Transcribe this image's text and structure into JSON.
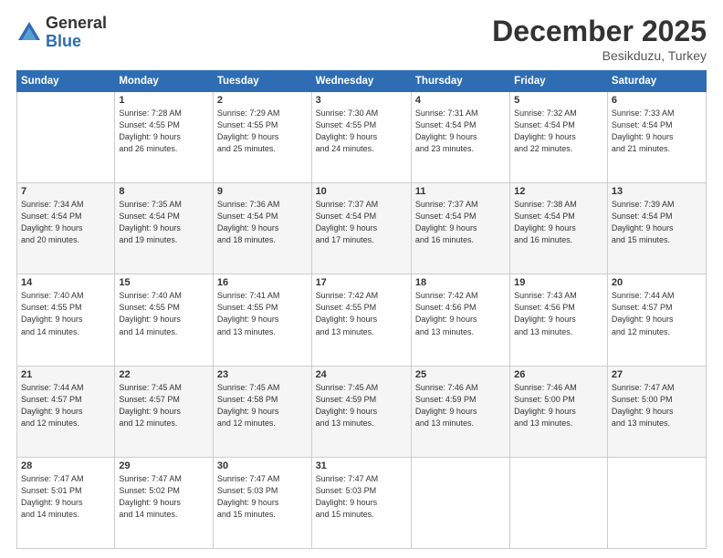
{
  "logo": {
    "general": "General",
    "blue": "Blue"
  },
  "header": {
    "month": "December 2025",
    "location": "Besikduzu, Turkey"
  },
  "days_of_week": [
    "Sunday",
    "Monday",
    "Tuesday",
    "Wednesday",
    "Thursday",
    "Friday",
    "Saturday"
  ],
  "weeks": [
    [
      {
        "day": "",
        "content": ""
      },
      {
        "day": "1",
        "content": "Sunrise: 7:28 AM\nSunset: 4:55 PM\nDaylight: 9 hours\nand 26 minutes."
      },
      {
        "day": "2",
        "content": "Sunrise: 7:29 AM\nSunset: 4:55 PM\nDaylight: 9 hours\nand 25 minutes."
      },
      {
        "day": "3",
        "content": "Sunrise: 7:30 AM\nSunset: 4:55 PM\nDaylight: 9 hours\nand 24 minutes."
      },
      {
        "day": "4",
        "content": "Sunrise: 7:31 AM\nSunset: 4:54 PM\nDaylight: 9 hours\nand 23 minutes."
      },
      {
        "day": "5",
        "content": "Sunrise: 7:32 AM\nSunset: 4:54 PM\nDaylight: 9 hours\nand 22 minutes."
      },
      {
        "day": "6",
        "content": "Sunrise: 7:33 AM\nSunset: 4:54 PM\nDaylight: 9 hours\nand 21 minutes."
      }
    ],
    [
      {
        "day": "7",
        "content": "Sunrise: 7:34 AM\nSunset: 4:54 PM\nDaylight: 9 hours\nand 20 minutes."
      },
      {
        "day": "8",
        "content": "Sunrise: 7:35 AM\nSunset: 4:54 PM\nDaylight: 9 hours\nand 19 minutes."
      },
      {
        "day": "9",
        "content": "Sunrise: 7:36 AM\nSunset: 4:54 PM\nDaylight: 9 hours\nand 18 minutes."
      },
      {
        "day": "10",
        "content": "Sunrise: 7:37 AM\nSunset: 4:54 PM\nDaylight: 9 hours\nand 17 minutes."
      },
      {
        "day": "11",
        "content": "Sunrise: 7:37 AM\nSunset: 4:54 PM\nDaylight: 9 hours\nand 16 minutes."
      },
      {
        "day": "12",
        "content": "Sunrise: 7:38 AM\nSunset: 4:54 PM\nDaylight: 9 hours\nand 16 minutes."
      },
      {
        "day": "13",
        "content": "Sunrise: 7:39 AM\nSunset: 4:54 PM\nDaylight: 9 hours\nand 15 minutes."
      }
    ],
    [
      {
        "day": "14",
        "content": "Sunrise: 7:40 AM\nSunset: 4:55 PM\nDaylight: 9 hours\nand 14 minutes."
      },
      {
        "day": "15",
        "content": "Sunrise: 7:40 AM\nSunset: 4:55 PM\nDaylight: 9 hours\nand 14 minutes."
      },
      {
        "day": "16",
        "content": "Sunrise: 7:41 AM\nSunset: 4:55 PM\nDaylight: 9 hours\nand 13 minutes."
      },
      {
        "day": "17",
        "content": "Sunrise: 7:42 AM\nSunset: 4:55 PM\nDaylight: 9 hours\nand 13 minutes."
      },
      {
        "day": "18",
        "content": "Sunrise: 7:42 AM\nSunset: 4:56 PM\nDaylight: 9 hours\nand 13 minutes."
      },
      {
        "day": "19",
        "content": "Sunrise: 7:43 AM\nSunset: 4:56 PM\nDaylight: 9 hours\nand 13 minutes."
      },
      {
        "day": "20",
        "content": "Sunrise: 7:44 AM\nSunset: 4:57 PM\nDaylight: 9 hours\nand 12 minutes."
      }
    ],
    [
      {
        "day": "21",
        "content": "Sunrise: 7:44 AM\nSunset: 4:57 PM\nDaylight: 9 hours\nand 12 minutes."
      },
      {
        "day": "22",
        "content": "Sunrise: 7:45 AM\nSunset: 4:57 PM\nDaylight: 9 hours\nand 12 minutes."
      },
      {
        "day": "23",
        "content": "Sunrise: 7:45 AM\nSunset: 4:58 PM\nDaylight: 9 hours\nand 12 minutes."
      },
      {
        "day": "24",
        "content": "Sunrise: 7:45 AM\nSunset: 4:59 PM\nDaylight: 9 hours\nand 13 minutes."
      },
      {
        "day": "25",
        "content": "Sunrise: 7:46 AM\nSunset: 4:59 PM\nDaylight: 9 hours\nand 13 minutes."
      },
      {
        "day": "26",
        "content": "Sunrise: 7:46 AM\nSunset: 5:00 PM\nDaylight: 9 hours\nand 13 minutes."
      },
      {
        "day": "27",
        "content": "Sunrise: 7:47 AM\nSunset: 5:00 PM\nDaylight: 9 hours\nand 13 minutes."
      }
    ],
    [
      {
        "day": "28",
        "content": "Sunrise: 7:47 AM\nSunset: 5:01 PM\nDaylight: 9 hours\nand 14 minutes."
      },
      {
        "day": "29",
        "content": "Sunrise: 7:47 AM\nSunset: 5:02 PM\nDaylight: 9 hours\nand 14 minutes."
      },
      {
        "day": "30",
        "content": "Sunrise: 7:47 AM\nSunset: 5:03 PM\nDaylight: 9 hours\nand 15 minutes."
      },
      {
        "day": "31",
        "content": "Sunrise: 7:47 AM\nSunset: 5:03 PM\nDaylight: 9 hours\nand 15 minutes."
      },
      {
        "day": "",
        "content": ""
      },
      {
        "day": "",
        "content": ""
      },
      {
        "day": "",
        "content": ""
      }
    ]
  ]
}
